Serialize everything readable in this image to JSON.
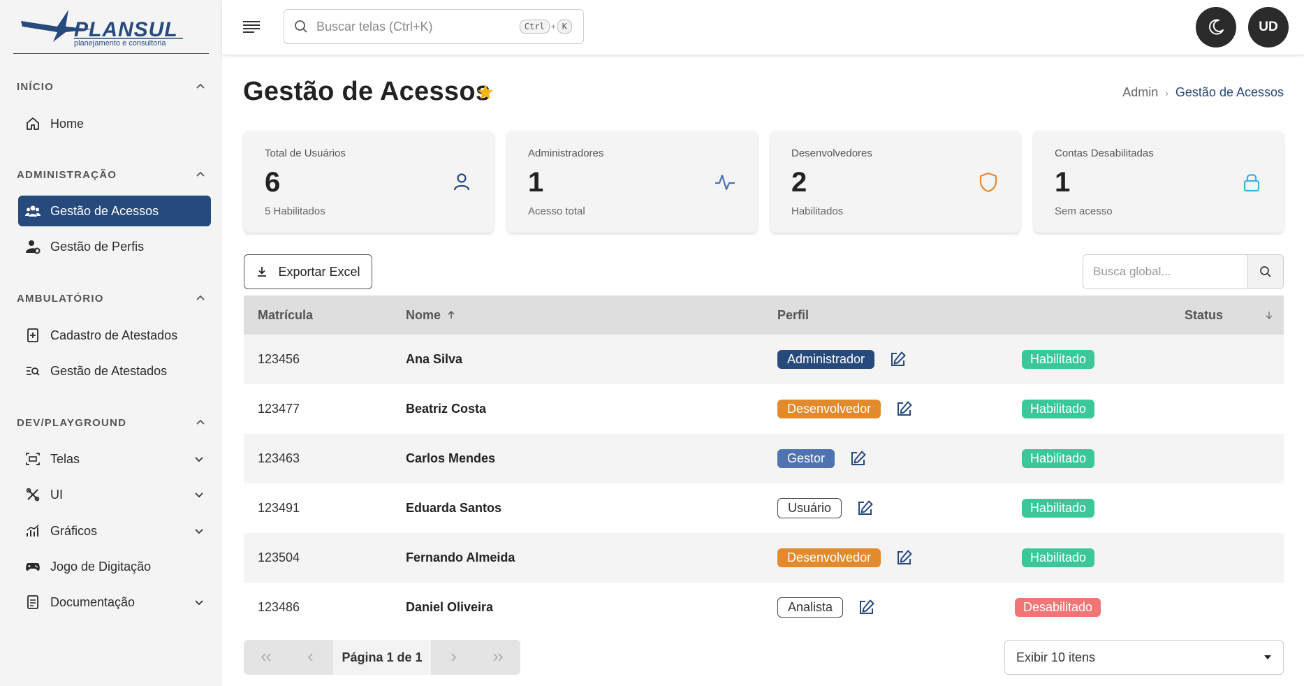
{
  "brand": {
    "name": "PLANSUL",
    "tagline": "planejamento e consultoria"
  },
  "sidebar": {
    "sections": [
      {
        "title": "INÍCIO",
        "items": [
          {
            "label": "Home",
            "icon": "home-icon"
          }
        ]
      },
      {
        "title": "ADMINISTRAÇÃO",
        "items": [
          {
            "label": "Gestão de Acessos",
            "icon": "users-icon",
            "active": true
          },
          {
            "label": "Gestão de Perfis",
            "icon": "user-gear-icon"
          }
        ]
      },
      {
        "title": "AMBULATÓRIO",
        "items": [
          {
            "label": "Cadastro de Atestados",
            "icon": "document-plus-icon"
          },
          {
            "label": "Gestão de Atestados",
            "icon": "list-search-icon"
          }
        ]
      },
      {
        "title": "DEV/PLAYGROUND",
        "items": [
          {
            "label": "Telas",
            "icon": "screen-icon",
            "expandable": true
          },
          {
            "label": "UI",
            "icon": "tools-icon",
            "expandable": true
          },
          {
            "label": "Gráficos",
            "icon": "chart-icon",
            "expandable": true
          },
          {
            "label": "Jogo de Digitação",
            "icon": "gamepad-icon"
          },
          {
            "label": "Documentação",
            "icon": "doc-icon",
            "expandable": true
          }
        ]
      }
    ]
  },
  "header": {
    "search_placeholder": "Buscar telas (Ctrl+K)",
    "shortcut_ctrl": "Ctrl",
    "shortcut_plus": "+",
    "shortcut_key": "K",
    "user_initials": "UD"
  },
  "page": {
    "title": "Gestão de Acessos",
    "breadcrumb": {
      "parent": "Admin",
      "current": "Gestão de Acessos"
    }
  },
  "cards": [
    {
      "label": "Total de Usuários",
      "value": "6",
      "sub": "5 Habilitados",
      "icon": "user-icon",
      "color": "#274a7c"
    },
    {
      "label": "Administradores",
      "value": "1",
      "sub": "Acesso total",
      "icon": "activity-icon",
      "color": "#4f73b0"
    },
    {
      "label": "Desenvolvedores",
      "value": "2",
      "sub": "Habilitados",
      "icon": "shield-icon",
      "color": "#e28a2c"
    },
    {
      "label": "Contas Desabilitadas",
      "value": "1",
      "sub": "Sem acesso",
      "icon": "lock-icon",
      "color": "#3ab0e6"
    }
  ],
  "toolbar": {
    "export_label": "Exportar Excel",
    "global_search_placeholder": "Busca global..."
  },
  "table": {
    "columns": {
      "matricula": "Matrícula",
      "nome": "Nome",
      "perfil": "Perfil",
      "status": "Status"
    },
    "rows": [
      {
        "matricula": "123456",
        "nome": "Ana Silva",
        "perfil": "Administrador",
        "perfil_style": "b-admin",
        "status": "Habilitado",
        "status_style": "s-on"
      },
      {
        "matricula": "123477",
        "nome": "Beatriz Costa",
        "perfil": "Desenvolvedor",
        "perfil_style": "b-dev",
        "status": "Habilitado",
        "status_style": "s-on"
      },
      {
        "matricula": "123463",
        "nome": "Carlos Mendes",
        "perfil": "Gestor",
        "perfil_style": "b-gestor",
        "status": "Habilitado",
        "status_style": "s-on"
      },
      {
        "matricula": "123491",
        "nome": "Eduarda Santos",
        "perfil": "Usuário",
        "perfil_style": "b-outline",
        "status": "Habilitado",
        "status_style": "s-on"
      },
      {
        "matricula": "123504",
        "nome": "Fernando Almeida",
        "perfil": "Desenvolvedor",
        "perfil_style": "b-dev",
        "status": "Habilitado",
        "status_style": "s-on"
      },
      {
        "matricula": "123486",
        "nome": "Daniel Oliveira",
        "perfil": "Analista",
        "perfil_style": "b-outline",
        "status": "Desabilitado",
        "status_style": "s-off"
      }
    ]
  },
  "pagination": {
    "label": "Página 1 de 1",
    "per_page": "Exibir 10 itens"
  }
}
